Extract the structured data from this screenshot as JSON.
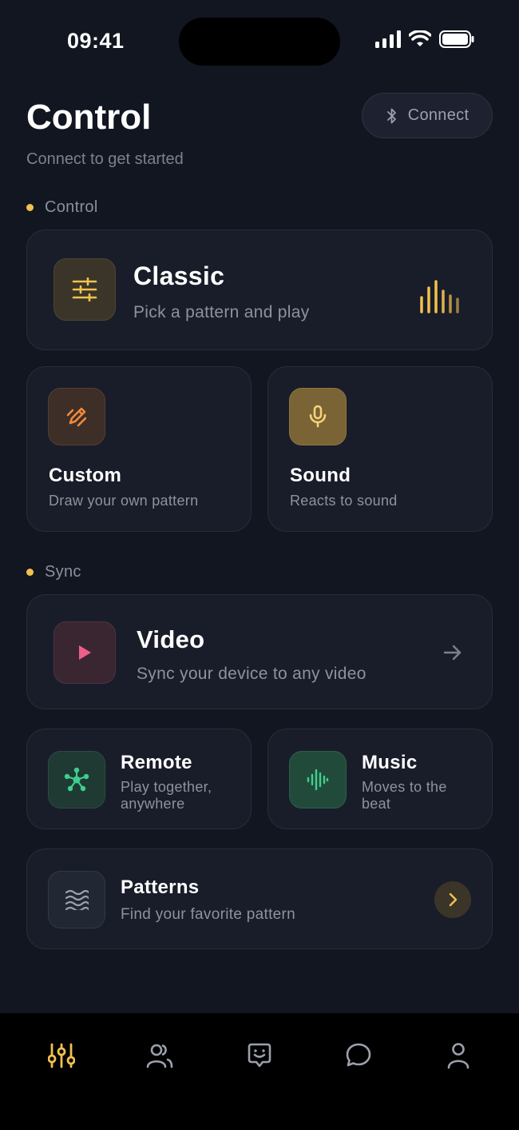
{
  "status_bar": {
    "time": "09:41"
  },
  "header": {
    "title": "Control",
    "subtitle": "Connect to get started",
    "connect_label": "Connect"
  },
  "sections": {
    "control_label": "Control",
    "sync_label": "Sync"
  },
  "cards": {
    "classic": {
      "title": "Classic",
      "desc": "Pick a pattern and play"
    },
    "custom": {
      "title": "Custom",
      "desc": "Draw your own pattern"
    },
    "sound": {
      "title": "Sound",
      "desc": "Reacts to sound"
    },
    "video": {
      "title": "Video",
      "desc": "Sync your device to any video"
    },
    "remote": {
      "title": "Remote",
      "desc": "Play together, anywhere"
    },
    "music": {
      "title": "Music",
      "desc": "Moves to the beat"
    },
    "patterns": {
      "title": "Patterns",
      "desc": "Find your favorite pattern"
    }
  },
  "nav": {
    "items": [
      {
        "icon": "sliders-icon",
        "active": true
      },
      {
        "icon": "users-icon",
        "active": false
      },
      {
        "icon": "smile-chat-icon",
        "active": false
      },
      {
        "icon": "chat-bubble-icon",
        "active": false
      },
      {
        "icon": "profile-icon",
        "active": false
      }
    ]
  },
  "colors": {
    "accent": "#f2c14e",
    "background": "#121620",
    "card": "#191d29"
  }
}
